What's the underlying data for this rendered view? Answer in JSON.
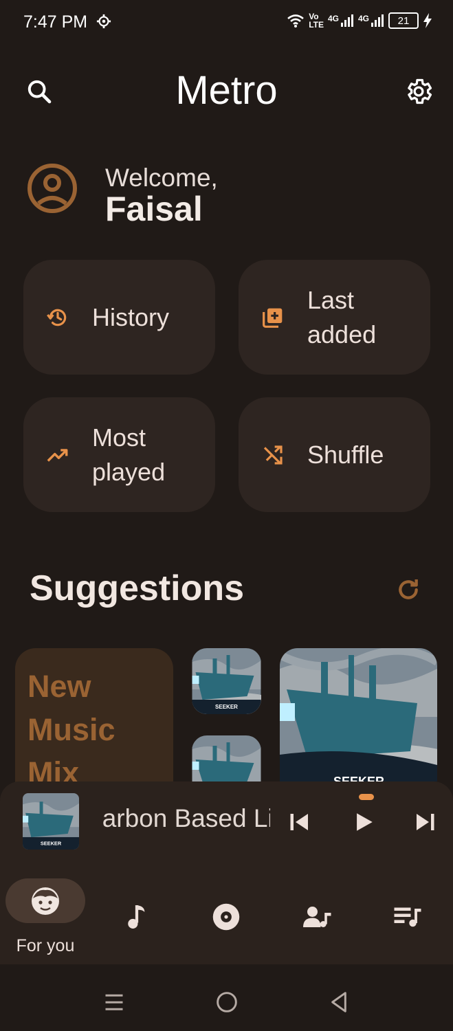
{
  "status_bar": {
    "time": "7:47 PM",
    "network_label_1": "Vo",
    "network_label_2": "LTE",
    "sim1_label": "4G",
    "sim2_label": "4G",
    "battery": "21"
  },
  "header": {
    "title": "Metro",
    "search_icon": "search-icon",
    "settings_icon": "gear-icon"
  },
  "welcome": {
    "label": "Welcome,",
    "name": "Faisal"
  },
  "quick_actions": [
    {
      "label_line1": "History",
      "label_line2": "",
      "icon": "history-icon"
    },
    {
      "label_line1": "Last",
      "label_line2": "added",
      "icon": "library-add-icon"
    },
    {
      "label_line1": "Most",
      "label_line2": "played",
      "icon": "trending-up-icon"
    },
    {
      "label_line1": "Shuffle",
      "label_line2": "",
      "icon": "shuffle-icon"
    }
  ],
  "suggestions": {
    "title": "Suggestions",
    "mix_line1": "New",
    "mix_line2": "Music",
    "mix_line3": "Mix",
    "album_text": "SEEKER"
  },
  "now_playing": {
    "song_title": "Carbon Based Lifeforms",
    "progress": 0.02
  },
  "bottom_nav": {
    "active_label": "For you",
    "items": [
      "for-you-icon",
      "music-note-icon",
      "album-icon",
      "artist-icon",
      "playlist-icon"
    ]
  },
  "colors": {
    "background": "#201a17",
    "surface": "#2e2521",
    "accent": "#e8924a",
    "accent_dark": "#9a6333"
  }
}
